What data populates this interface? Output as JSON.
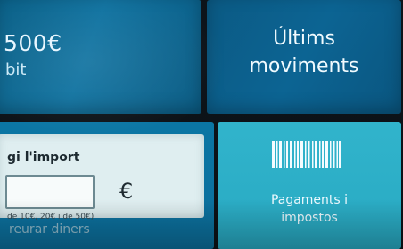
{
  "balance": {
    "amount": "500€",
    "caption": "bit"
  },
  "menu": {
    "last_movements_line1": "Últims",
    "last_movements_line2": "moviments",
    "payments_line1": "Pagaments i",
    "payments_line2": "impostos",
    "payments_icon": "barcode-icon"
  },
  "amount_form": {
    "title": "gi l'import",
    "input_value": "",
    "currency_symbol": "€",
    "hint": "de 10€, 20€ i de 50€)",
    "withdraw_label": "reurar diners"
  },
  "colors": {
    "balance_tile": "#0f72a0",
    "movements_tile": "#0c6493",
    "amount_tile": "#0b76a4",
    "payments_tile": "#31b4cc",
    "panel": "#dfeef0"
  }
}
